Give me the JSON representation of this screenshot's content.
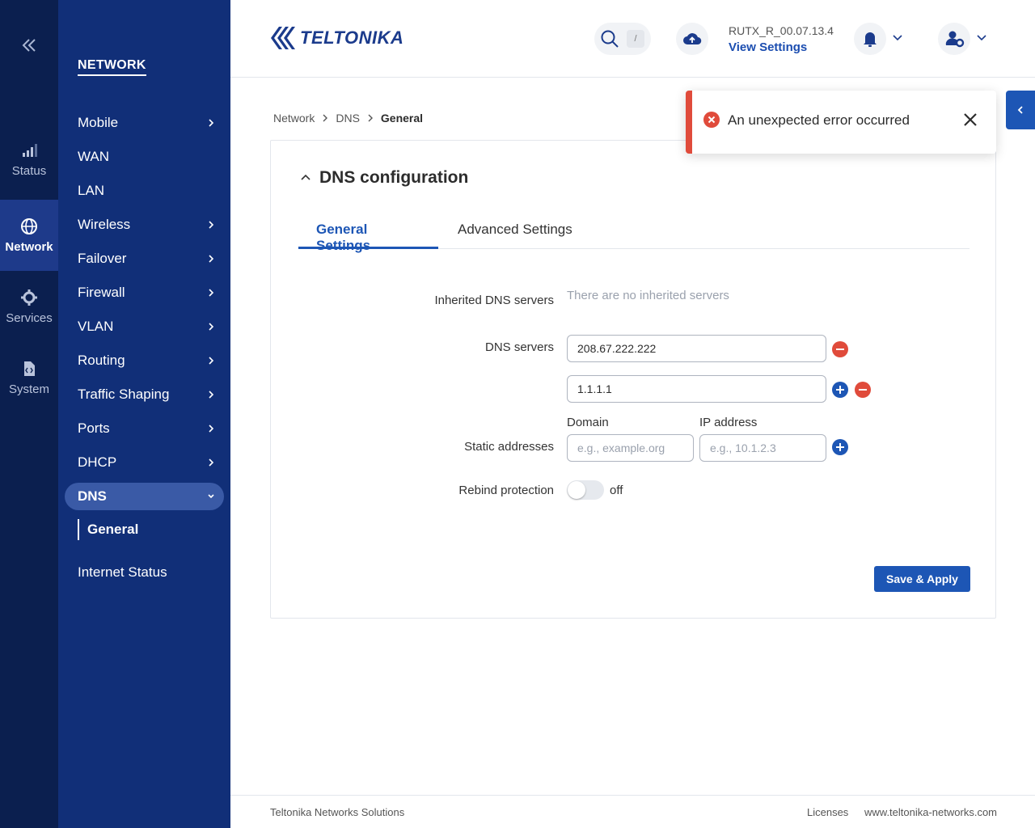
{
  "rail": {
    "items": [
      {
        "label": "Status",
        "icon": "signal-bars-icon"
      },
      {
        "label": "Network",
        "icon": "globe-icon"
      },
      {
        "label": "Services",
        "icon": "gear-icon"
      },
      {
        "label": "System",
        "icon": "file-code-icon"
      }
    ]
  },
  "nav": {
    "title": "NETWORK",
    "items": [
      {
        "label": "Mobile"
      },
      {
        "label": "WAN"
      },
      {
        "label": "LAN"
      },
      {
        "label": "Wireless"
      },
      {
        "label": "Failover"
      },
      {
        "label": "Firewall"
      },
      {
        "label": "VLAN"
      },
      {
        "label": "Routing"
      },
      {
        "label": "Traffic Shaping"
      },
      {
        "label": "Ports"
      },
      {
        "label": "DHCP"
      },
      {
        "label": "DNS"
      },
      {
        "label": "Internet Status"
      }
    ],
    "sub_item": "General"
  },
  "header": {
    "logo_text": "TELTONIKA",
    "search_shortcut": "/",
    "firmware": "RUTX_R_00.07.13.4",
    "view_settings": "View Settings"
  },
  "breadcrumb": {
    "items": [
      "Network",
      "DNS",
      "General"
    ]
  },
  "card": {
    "title": "DNS configuration",
    "tabs": [
      "General Settings",
      "Advanced Settings"
    ],
    "inherited_label": "Inherited DNS servers",
    "inherited_value": "There are no inherited servers",
    "dns_label": "DNS servers",
    "dns_servers": [
      "208.67.222.222",
      "1.1.1.1"
    ],
    "static_label": "Static addresses",
    "domain_label": "Domain",
    "ip_label": "IP address",
    "domain_placeholder": "e.g., example.org",
    "ip_placeholder": "e.g., 10.1.2.3",
    "rebind_label": "Rebind protection",
    "rebind_state": "off",
    "save_label": "Save & Apply"
  },
  "toast": {
    "message": "An unexpected error occurred"
  },
  "footer": {
    "company": "Teltonika Networks Solutions",
    "licenses": "Licenses",
    "website": "www.teltonika-networks.com"
  },
  "colors": {
    "rail_bg": "#0b1f4f",
    "nav_bg": "#112f78",
    "accent": "#1d56b5",
    "error": "#e04b3b"
  }
}
